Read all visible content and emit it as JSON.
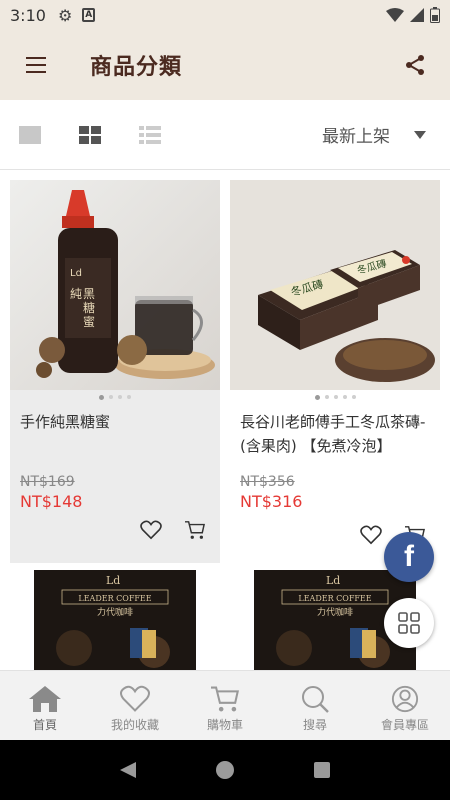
{
  "status_bar": {
    "time": "3:10",
    "icons": [
      "gear-icon",
      "a-icon",
      "wifi-icon",
      "signal-icon",
      "battery-icon"
    ]
  },
  "app_bar": {
    "title": "商品分類",
    "icons": [
      "menu-icon",
      "share-icon"
    ]
  },
  "toolbar": {
    "view_modes": [
      "single-view-icon",
      "grid-view-icon",
      "list-view-icon"
    ],
    "active_view": "grid-view-icon",
    "sort_selected": "最新上架"
  },
  "products": [
    {
      "name": "手作純黑糖蜜",
      "old_price": "NT$169",
      "new_price": "NT$148",
      "image": "black-sugar-syrup-bottle",
      "slides": 4,
      "active_slide": 0
    },
    {
      "name": "長谷川老師傅手工冬瓜茶磚- (含果肉) 【免煮冷泡】",
      "old_price": "NT$356",
      "new_price": "NT$316",
      "image": "winter-melon-tea-brick",
      "slides": 5,
      "active_slide": 0
    },
    {
      "image": "leader-coffee-box",
      "brand": "LEADER COFFEE",
      "brand_cn": "力代咖啡",
      "logo_text": "Ld"
    },
    {
      "image": "leader-coffee-box",
      "brand": "LEADER COFFEE",
      "brand_cn": "力代咖啡",
      "logo_text": "Ld"
    }
  ],
  "floating": {
    "facebook_letter": "f"
  },
  "bottom_nav": [
    {
      "label": "首頁",
      "icon": "home-icon"
    },
    {
      "label": "我的收藏",
      "icon": "heart-icon"
    },
    {
      "label": "購物車",
      "icon": "cart-icon"
    },
    {
      "label": "搜尋",
      "icon": "search-icon"
    },
    {
      "label": "會員專區",
      "icon": "user-icon"
    }
  ],
  "colors": {
    "header_bg": "#efe9e0",
    "title": "#4b2a20",
    "price": "#e53935",
    "facebook": "#3b5998"
  }
}
